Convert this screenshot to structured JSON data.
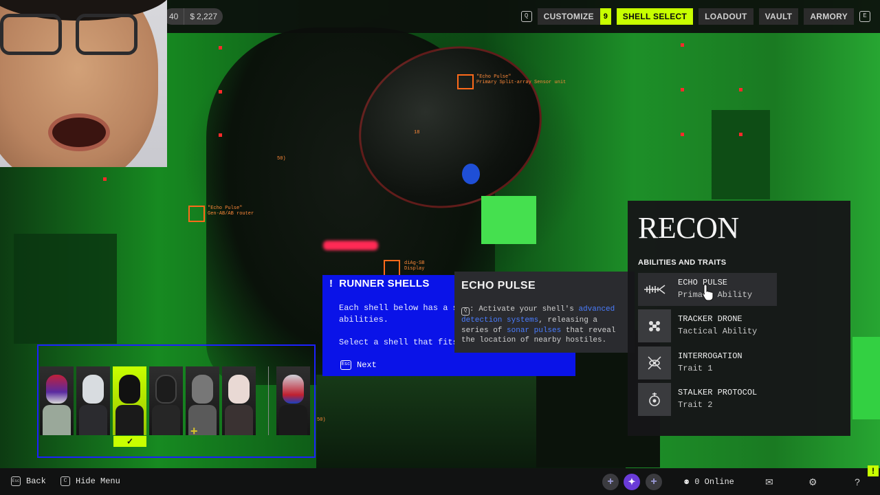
{
  "currency": {
    "left_value": "40",
    "credits": "2,227"
  },
  "nav": {
    "customize": "CUSTOMIZE",
    "customize_badge": "9",
    "shell_select": "SHELL SELECT",
    "loadout": "LOADOUT",
    "vault": "VAULT",
    "armory": "ARMORY",
    "left_key": "Q",
    "right_key": "E"
  },
  "annotations": {
    "echo_title": "\"Echo Pulse\"",
    "echo_sub": "Primary Split-array Sensor unit",
    "router_title": "\"Echo Pulse\"",
    "router_sub": "Gen-AB/AB router",
    "diag_title": "diAg-SB",
    "diag_sub": "Display",
    "num18": "18",
    "num_50a": "50)",
    "num_50b": "50)"
  },
  "runner_shells": {
    "title": "RUNNER SHELLS",
    "line1": "Each shell below has a s",
    "line2": "abilities.",
    "line3": "Select a shell that fits",
    "next_key": "Esc",
    "next_label": "Next"
  },
  "echo_tooltip": {
    "title": "ECHO PULSE",
    "key": "Q",
    "text_a": ": Activate your shell's ",
    "hl_a": "advanced detection systems",
    "text_b": ", releasing a series of ",
    "hl_b": "sonar pulses",
    "text_c": " that reveal the location of nearby hostiles."
  },
  "shells": {
    "selected_check": "✓",
    "plus_mark": "+",
    "portraits": [
      {
        "name": "shell-1",
        "head": "#c0203a",
        "body": "#9aa89a"
      },
      {
        "name": "shell-2",
        "head": "#d8dce0",
        "body": "#2b2b2f"
      },
      {
        "name": "shell-3",
        "head": "#111111",
        "body": "#1a1a1a"
      },
      {
        "name": "shell-4",
        "head": "#1c1c1c",
        "body": "#262626"
      },
      {
        "name": "shell-5",
        "head": "#777777",
        "body": "#5a5a5a"
      },
      {
        "name": "shell-6",
        "head": "#e9d9d4",
        "body": "#3a3232"
      },
      {
        "name": "shell-7",
        "head": "#d0d0d8",
        "body": "#1a1a1a"
      }
    ]
  },
  "recon": {
    "title": "RECON",
    "section": "ABILITIES AND TRAITS",
    "abilities": [
      {
        "name": "ECHO PULSE",
        "type": "Primary Ability",
        "icon": "sonar-icon"
      },
      {
        "name": "TRACKER DRONE",
        "type": "Tactical Ability",
        "icon": "drone-icon"
      },
      {
        "name": "INTERROGATION",
        "type": "Trait 1",
        "icon": "eye-icon"
      },
      {
        "name": "STALKER PROTOCOL",
        "type": "Trait 2",
        "icon": "target-icon"
      }
    ]
  },
  "bottom": {
    "back_key": "Esc",
    "back": "Back",
    "hide_key": "C",
    "hide_menu": "Hide Menu",
    "online": "0 Online",
    "help": "?",
    "corner_badge": "!"
  },
  "colors": {
    "accent": "#c8ff00",
    "tooltip_blue": "#0a13e8",
    "marker_orange": "#ff6a1a"
  }
}
